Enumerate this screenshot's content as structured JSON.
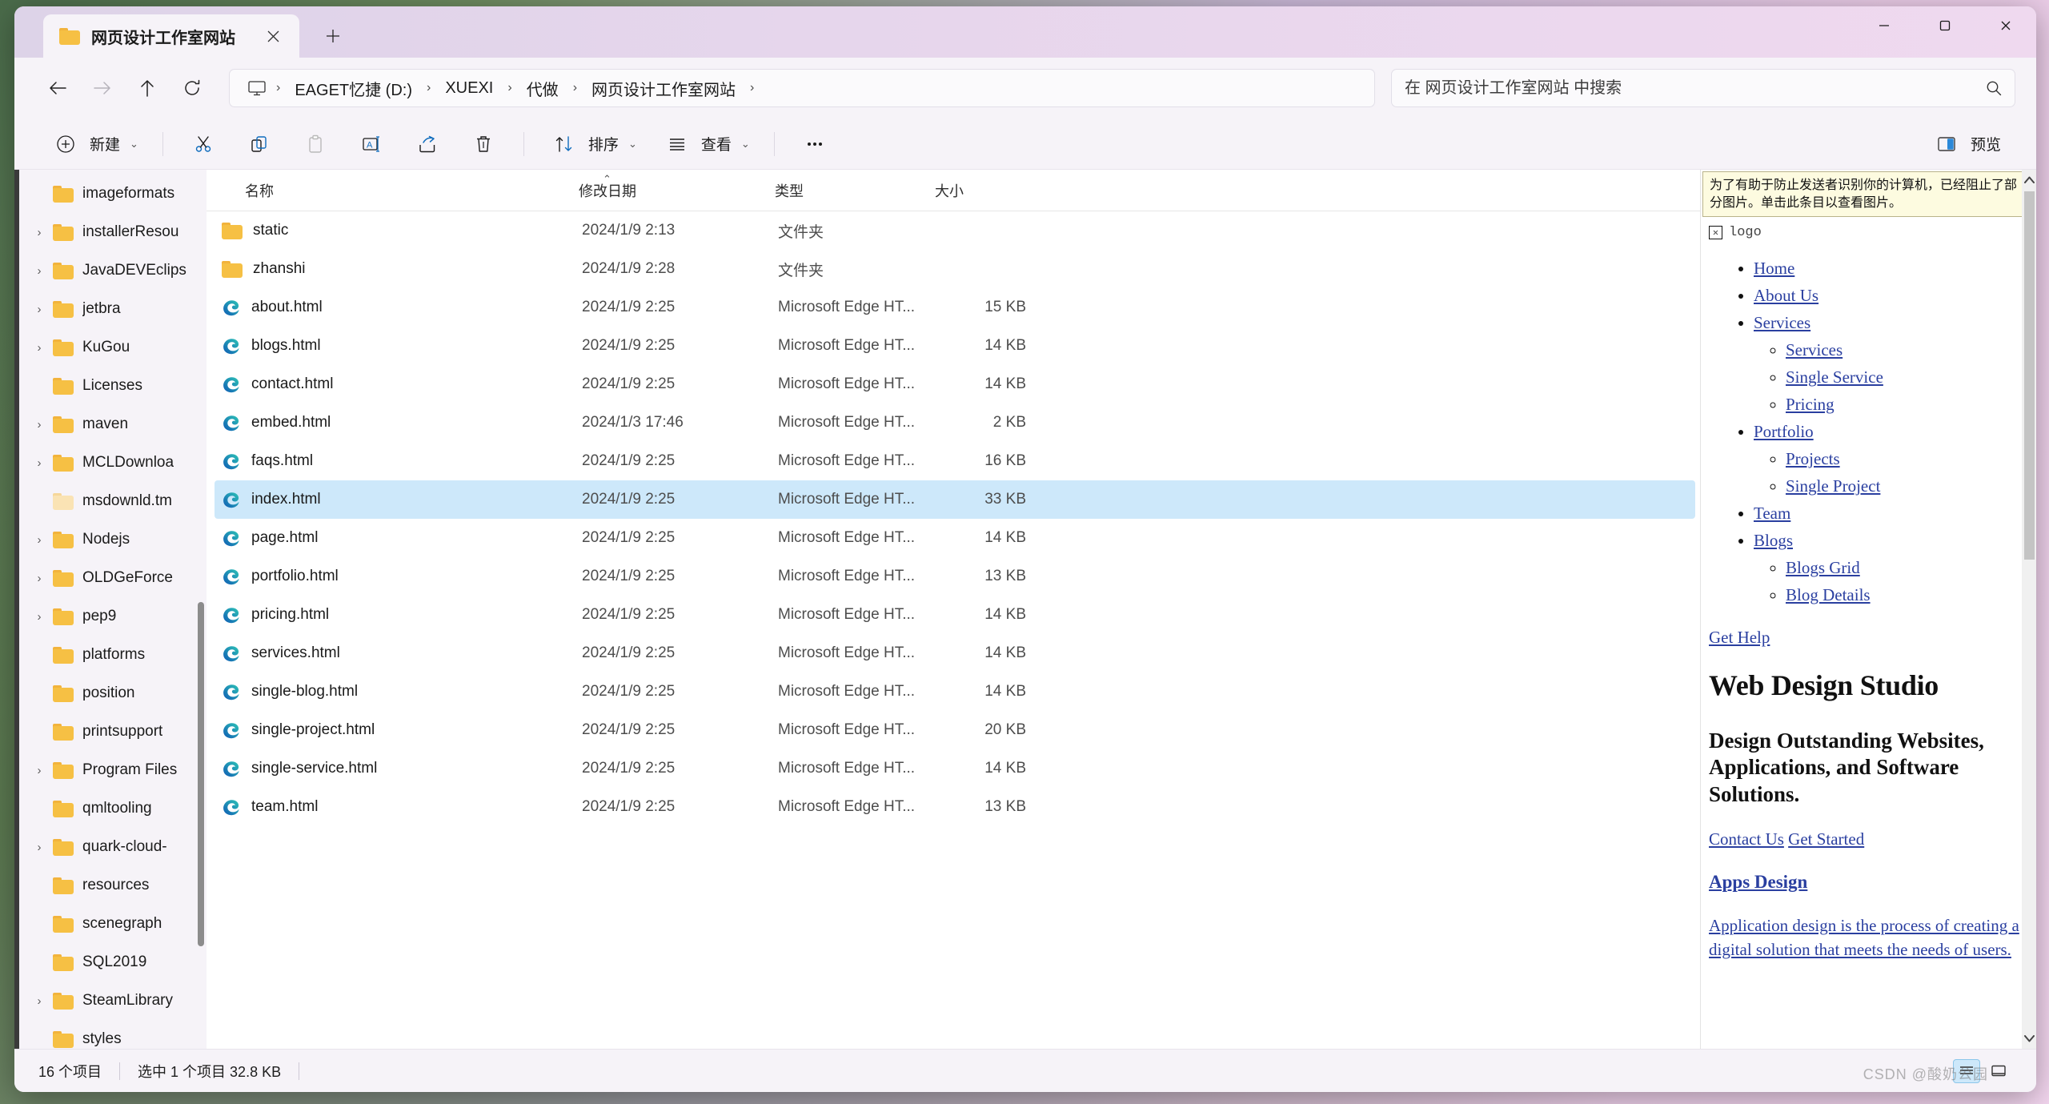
{
  "window": {
    "tab_title": "网页设计工作室网站",
    "tab_folder_icon": "folder-icon",
    "close_tab_icon": "close-icon",
    "new_tab_icon": "plus-icon",
    "minimize_icon": "minimize-icon",
    "maximize_icon": "maximize-icon",
    "close_icon": "close-icon"
  },
  "nav": {
    "back_icon": "arrow-left-icon",
    "forward_icon": "arrow-right-icon",
    "up_icon": "arrow-up-icon",
    "refresh_icon": "refresh-icon",
    "pc_icon": "this-pc-icon",
    "breadcrumbs": [
      "EAGET忆捷 (D:)",
      "XUEXI",
      "代做",
      "网页设计工作室网站"
    ],
    "separator": "›"
  },
  "search": {
    "placeholder": "在 网页设计工作室网站 中搜索",
    "value": "",
    "icon": "search-icon"
  },
  "toolbar": {
    "new_label": "新建",
    "new_icon": "plus-circle-icon",
    "cut_icon": "scissors-icon",
    "copy_icon": "copy-icon",
    "paste_icon": "paste-icon",
    "rename_icon": "rename-icon",
    "share_icon": "share-icon",
    "delete_icon": "trash-icon",
    "sort_label": "排序",
    "sort_icon": "sort-arrows-icon",
    "view_label": "查看",
    "view_icon": "list-lines-icon",
    "more_icon": "ellipsis-icon",
    "preview_label": "预览",
    "preview_icon": "preview-pane-icon",
    "chevron": "⌄"
  },
  "sidebar": {
    "items": [
      {
        "label": "imageformats",
        "expandable": false,
        "pale": false
      },
      {
        "label": "installerResou",
        "expandable": true,
        "pale": false
      },
      {
        "label": "JavaDEVEclips",
        "expandable": true,
        "pale": false
      },
      {
        "label": "jetbra",
        "expandable": true,
        "pale": false
      },
      {
        "label": "KuGou",
        "expandable": true,
        "pale": false
      },
      {
        "label": "Licenses",
        "expandable": false,
        "pale": false
      },
      {
        "label": "maven",
        "expandable": true,
        "pale": false
      },
      {
        "label": "MCLDownloa",
        "expandable": true,
        "pale": false
      },
      {
        "label": "msdownld.tm",
        "expandable": false,
        "pale": true
      },
      {
        "label": "Nodejs",
        "expandable": true,
        "pale": false
      },
      {
        "label": "OLDGeForce ",
        "expandable": true,
        "pale": false
      },
      {
        "label": "pep9",
        "expandable": true,
        "pale": false
      },
      {
        "label": "platforms",
        "expandable": false,
        "pale": false
      },
      {
        "label": "position",
        "expandable": false,
        "pale": false
      },
      {
        "label": "printsupport",
        "expandable": false,
        "pale": false
      },
      {
        "label": "Program Files",
        "expandable": true,
        "pale": false
      },
      {
        "label": "qmltooling",
        "expandable": false,
        "pale": false
      },
      {
        "label": "quark-cloud-",
        "expandable": true,
        "pale": false
      },
      {
        "label": "resources",
        "expandable": false,
        "pale": false
      },
      {
        "label": "scenegraph",
        "expandable": false,
        "pale": false
      },
      {
        "label": "SQL2019",
        "expandable": false,
        "pale": false
      },
      {
        "label": "SteamLibrary",
        "expandable": true,
        "pale": false
      },
      {
        "label": "styles",
        "expandable": false,
        "pale": false
      }
    ],
    "expander_glyph": "›"
  },
  "filelist": {
    "columns": {
      "name": "名称",
      "date": "修改日期",
      "type": "类型",
      "size": "大小"
    },
    "sort_caret": "⌃",
    "rows": [
      {
        "name": "static",
        "date": "2024/1/9 2:13",
        "type": "文件夹",
        "size": "",
        "kind": "folder",
        "selected": false
      },
      {
        "name": "zhanshi",
        "date": "2024/1/9 2:28",
        "type": "文件夹",
        "size": "",
        "kind": "folder",
        "selected": false
      },
      {
        "name": "about.html",
        "date": "2024/1/9 2:25",
        "type": "Microsoft Edge HT...",
        "size": "15 KB",
        "kind": "edge",
        "selected": false
      },
      {
        "name": "blogs.html",
        "date": "2024/1/9 2:25",
        "type": "Microsoft Edge HT...",
        "size": "14 KB",
        "kind": "edge",
        "selected": false
      },
      {
        "name": "contact.html",
        "date": "2024/1/9 2:25",
        "type": "Microsoft Edge HT...",
        "size": "14 KB",
        "kind": "edge",
        "selected": false
      },
      {
        "name": "embed.html",
        "date": "2024/1/3 17:46",
        "type": "Microsoft Edge HT...",
        "size": "2 KB",
        "kind": "edge",
        "selected": false
      },
      {
        "name": "faqs.html",
        "date": "2024/1/9 2:25",
        "type": "Microsoft Edge HT...",
        "size": "16 KB",
        "kind": "edge",
        "selected": false
      },
      {
        "name": "index.html",
        "date": "2024/1/9 2:25",
        "type": "Microsoft Edge HT...",
        "size": "33 KB",
        "kind": "edge",
        "selected": true
      },
      {
        "name": "page.html",
        "date": "2024/1/9 2:25",
        "type": "Microsoft Edge HT...",
        "size": "14 KB",
        "kind": "edge",
        "selected": false
      },
      {
        "name": "portfolio.html",
        "date": "2024/1/9 2:25",
        "type": "Microsoft Edge HT...",
        "size": "13 KB",
        "kind": "edge",
        "selected": false
      },
      {
        "name": "pricing.html",
        "date": "2024/1/9 2:25",
        "type": "Microsoft Edge HT...",
        "size": "14 KB",
        "kind": "edge",
        "selected": false
      },
      {
        "name": "services.html",
        "date": "2024/1/9 2:25",
        "type": "Microsoft Edge HT...",
        "size": "14 KB",
        "kind": "edge",
        "selected": false
      },
      {
        "name": "single-blog.html",
        "date": "2024/1/9 2:25",
        "type": "Microsoft Edge HT...",
        "size": "14 KB",
        "kind": "edge",
        "selected": false
      },
      {
        "name": "single-project.html",
        "date": "2024/1/9 2:25",
        "type": "Microsoft Edge HT...",
        "size": "20 KB",
        "kind": "edge",
        "selected": false
      },
      {
        "name": "single-service.html",
        "date": "2024/1/9 2:25",
        "type": "Microsoft Edge HT...",
        "size": "14 KB",
        "kind": "edge",
        "selected": false
      },
      {
        "name": "team.html",
        "date": "2024/1/9 2:25",
        "type": "Microsoft Edge HT...",
        "size": "13 KB",
        "kind": "edge",
        "selected": false
      }
    ]
  },
  "preview": {
    "warning": "为了有助于防止发送者识别你的计算机，已经阻止了部分图片。单击此条目以查看图片。",
    "logo_alt": "logo",
    "nav": [
      {
        "label": "Home",
        "children": []
      },
      {
        "label": "About Us",
        "children": []
      },
      {
        "label": "Services",
        "children": [
          "Services",
          "Single Service",
          "Pricing"
        ]
      },
      {
        "label": "Portfolio",
        "children": [
          "Projects",
          "Single Project"
        ]
      },
      {
        "label": "Team",
        "children": []
      },
      {
        "label": "Blogs",
        "children": [
          "Blogs Grid",
          "Blog Details"
        ]
      }
    ],
    "get_help": "Get Help",
    "h1": "Web Design Studio",
    "h2": "Design Outstanding Websites, Applications, and Software Solutions.",
    "cta_1": "Contact Us",
    "cta_2": "Get Started",
    "apps_design": "Apps Design",
    "paragraph": "Application design is the process of creating a digital solution that meets the needs of users.",
    "scroll_up_icon": "chevron-up-icon",
    "scroll_down_icon": "chevron-down-icon"
  },
  "statusbar": {
    "item_count": "16 个项目",
    "selection": "选中 1 个项目  32.8 KB",
    "details_view_icon": "details-view-icon",
    "large_icons_view_icon": "large-icons-view-icon"
  },
  "watermark": "CSDN @酸奶公园"
}
